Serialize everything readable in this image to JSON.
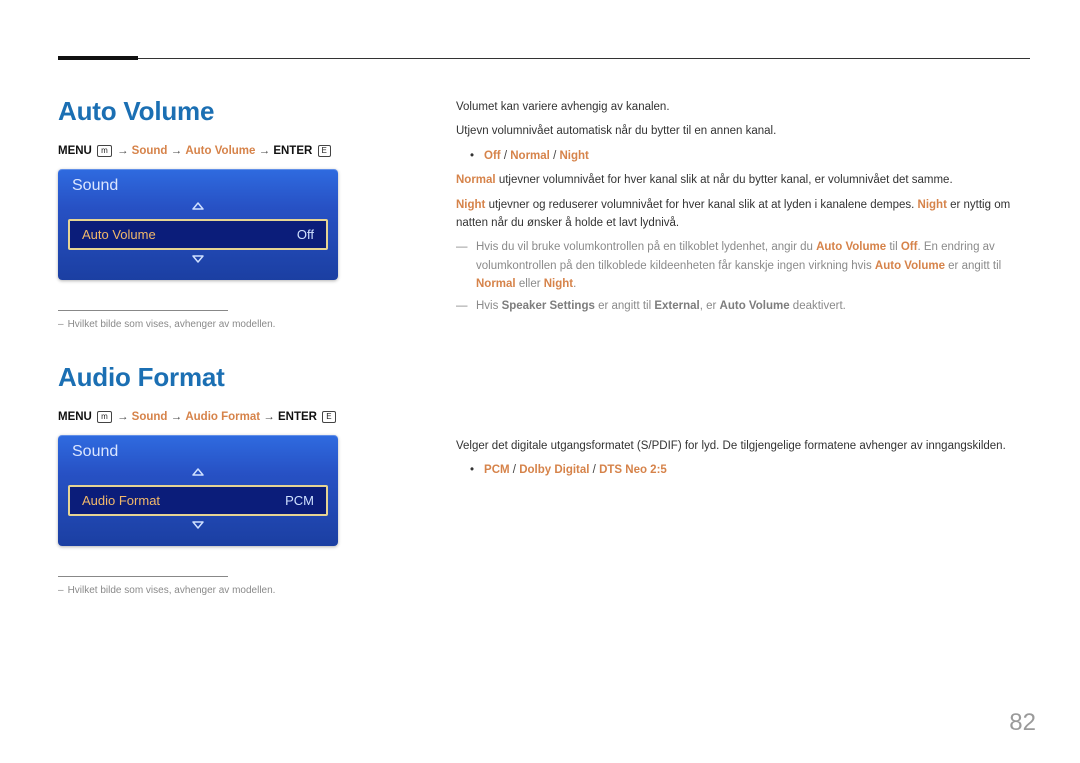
{
  "page_number": "82",
  "footnote_text": "Hvilket bilde som vises, avhenger av modellen.",
  "nav": {
    "menu_label": "MENU",
    "menu_icon": "m",
    "enter_label": "ENTER",
    "enter_icon": "E",
    "arrow": "→",
    "sound": "Sound"
  },
  "section1": {
    "title": "Auto Volume",
    "nav_item": "Auto Volume",
    "menu": {
      "header": "Sound",
      "row_name": "Auto Volume",
      "row_value": "Off"
    },
    "body": {
      "p1": "Volumet kan variere avhengig av kanalen.",
      "p2": "Utjevn volumnivået automatisk når du bytter til en annen kanal.",
      "opts": {
        "a": "Off",
        "b": "Normal",
        "c": "Night"
      },
      "normal_label": "Normal",
      "normal_text": " utjevner volumnivået for hver kanal slik at når du bytter kanal, er volumnivået det samme.",
      "night_label": "Night",
      "night_text1": " utjevner og reduserer volumnivået for hver kanal slik at at lyden i kanalene dempes. ",
      "night_label2": "Night",
      "night_text2": " er nyttig om natten når du ønsker å holde et lavt lydnivå.",
      "note1_pre": "Hvis du vil bruke volumkontrollen på en tilkoblet lydenhet, angir du ",
      "note1_av": "Auto Volume",
      "note1_mid": " til ",
      "note1_off": "Off",
      "note1_post1": ". En endring av volumkontrollen på den tilkoblede kildeenheten får kanskje ingen virkning hvis ",
      "note1_av2": "Auto Volume",
      "note1_post2": " er angitt til ",
      "note1_normal": "Normal",
      "note1_or": " eller ",
      "note1_night": "Night",
      "note1_end": ".",
      "note2_pre": "Hvis ",
      "note2_ss": "Speaker Settings",
      "note2_mid": " er angitt til ",
      "note2_ext": "External",
      "note2_mid2": ", er ",
      "note2_av": "Auto Volume",
      "note2_end": " deaktivert."
    }
  },
  "section2": {
    "title": "Audio Format",
    "nav_item": "Audio Format",
    "menu": {
      "header": "Sound",
      "row_name": "Audio Format",
      "row_value": "PCM"
    },
    "body": {
      "p1": "Velger det digitale utgangsformatet (S/PDIF) for lyd. De tilgjengelige formatene avhenger av inngangskilden.",
      "opts": {
        "a": "PCM",
        "b": "Dolby Digital",
        "c": "DTS Neo 2:5"
      }
    }
  }
}
